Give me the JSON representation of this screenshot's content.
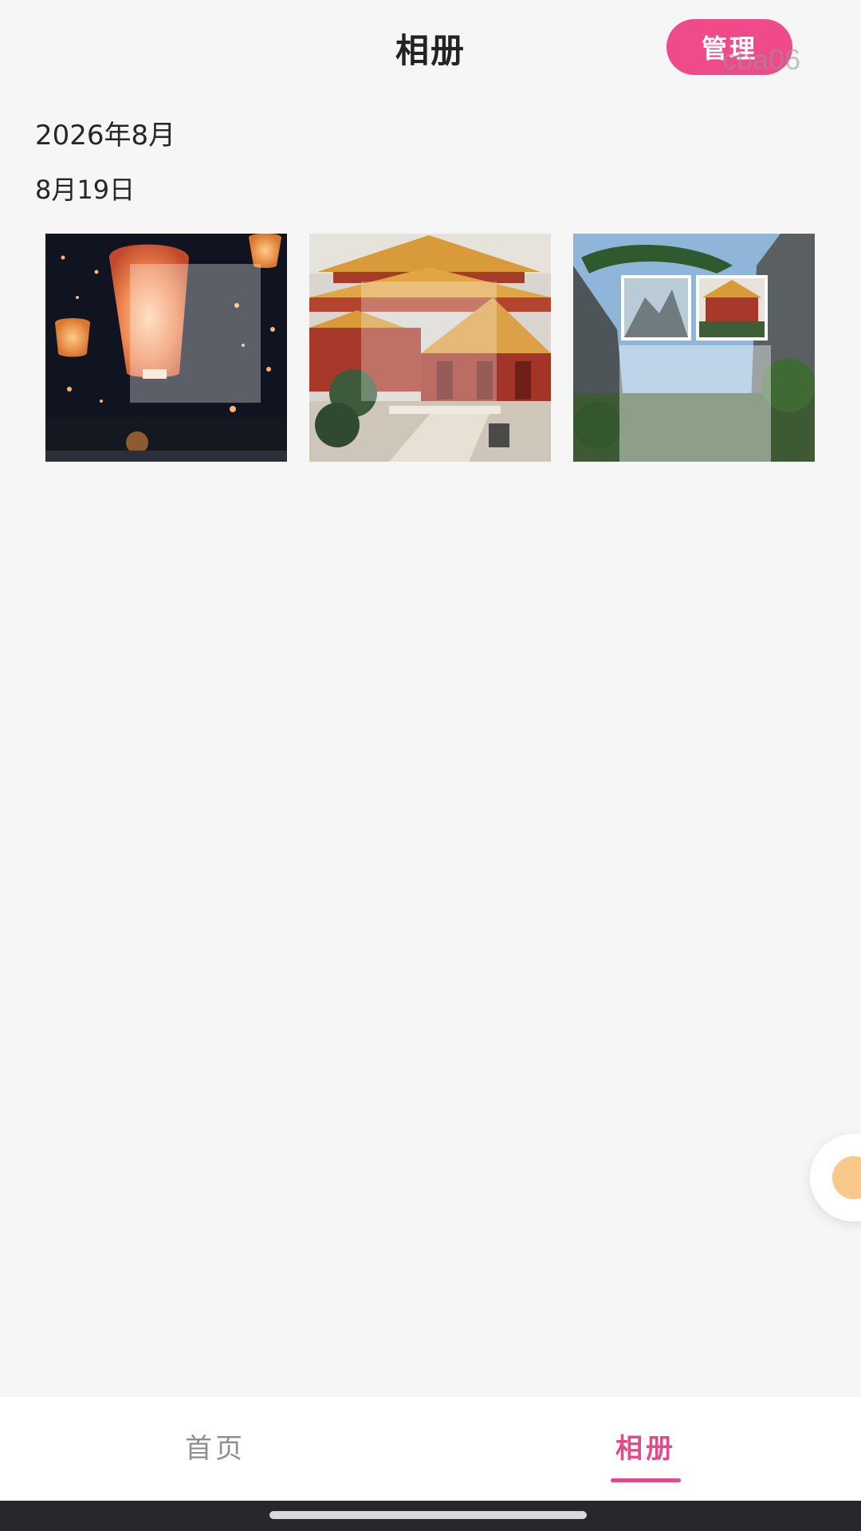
{
  "header": {
    "title": "相册",
    "manage_label": "管理",
    "watermark": "cba06"
  },
  "album": {
    "month": "2026年8月",
    "day": "8月19日",
    "photos": [
      {
        "subject": "sky lanterns at night"
      },
      {
        "subject": "palace with golden roof"
      },
      {
        "subject": "mountain pines collage"
      }
    ]
  },
  "tabs": [
    {
      "label": "首页",
      "active": false
    },
    {
      "label": "相册",
      "active": true
    }
  ],
  "colors": {
    "accent": "#ef4a8a",
    "tab_active": "#e04b8a",
    "tab_inactive": "#8d8d92",
    "background": "#f6f6f7"
  }
}
